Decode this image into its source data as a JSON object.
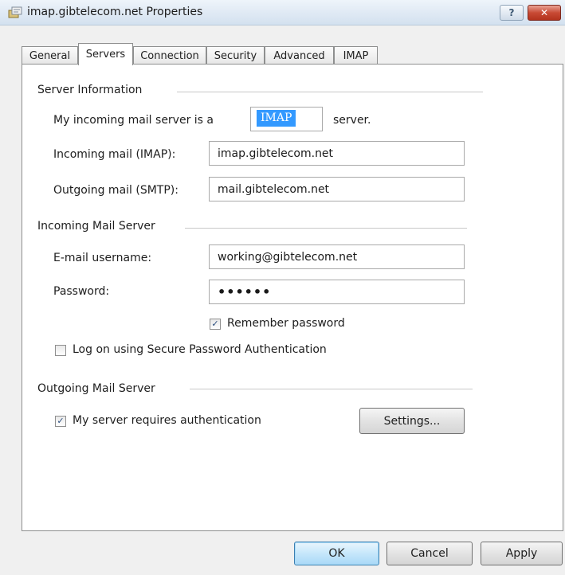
{
  "window": {
    "title": "imap.gibtelecom.net Properties",
    "help_glyph": "?",
    "close_glyph": "✕",
    "title_icon": "mail-account-icon"
  },
  "tabs": [
    {
      "label": "General",
      "active": false
    },
    {
      "label": "Servers",
      "active": true
    },
    {
      "label": "Connection",
      "active": false
    },
    {
      "label": "Security",
      "active": false
    },
    {
      "label": "Advanced",
      "active": false
    },
    {
      "label": "IMAP",
      "active": false
    }
  ],
  "server_info": {
    "title": "Server Information",
    "incoming_type_prefix": "My incoming mail server is a",
    "incoming_type_value": "IMAP",
    "incoming_type_suffix": "server.",
    "incoming_label": "Incoming mail (IMAP):",
    "incoming_value": "imap.gibtelecom.net",
    "outgoing_label": "Outgoing mail (SMTP):",
    "outgoing_value": "mail.gibtelecom.net"
  },
  "incoming_server": {
    "title": "Incoming Mail Server",
    "username_label": "E-mail username:",
    "username_value": "working@gibtelecom.net",
    "password_label": "Password:",
    "password_value": "••••••",
    "remember_label": "Remember password",
    "remember_checked": true,
    "spa_label": "Log on using Secure Password Authentication",
    "spa_checked": false
  },
  "outgoing_server": {
    "title": "Outgoing Mail Server",
    "auth_label": "My server requires authentication",
    "auth_checked": true,
    "settings_label": "Settings..."
  },
  "footer": {
    "ok_label": "OK",
    "cancel_label": "Cancel",
    "apply_label": "Apply"
  },
  "glyphs": {
    "checked": "✓",
    "unchecked": ""
  },
  "colors": {
    "selection": "#3399ff",
    "close_button": "#c84a35"
  }
}
